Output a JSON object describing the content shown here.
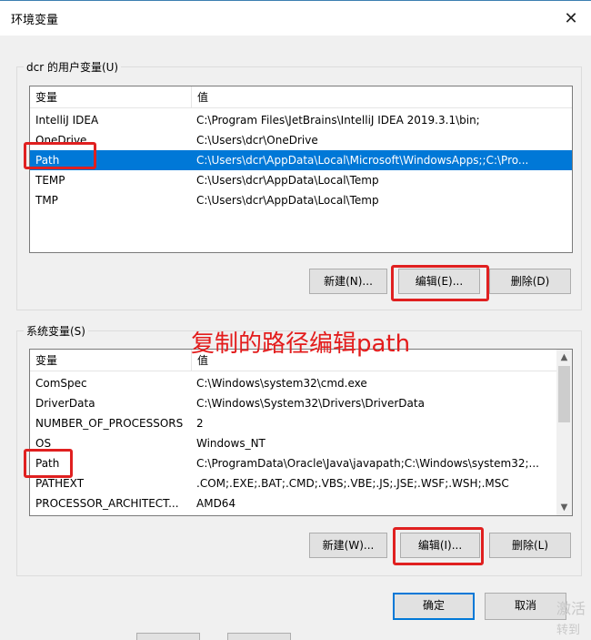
{
  "window": {
    "title": "环境变量",
    "close_glyph": "✕"
  },
  "user_vars": {
    "group_label": "dcr 的用户变量(U)",
    "col_var": "变量",
    "col_val": "值",
    "rows": [
      {
        "name": "IntelliJ IDEA",
        "value": "C:\\Program Files\\JetBrains\\IntelliJ IDEA 2019.3.1\\bin;"
      },
      {
        "name": "OneDrive",
        "value": "C:\\Users\\dcr\\OneDrive"
      },
      {
        "name": "Path",
        "value": "C:\\Users\\dcr\\AppData\\Local\\Microsoft\\WindowsApps;;C:\\Pro..."
      },
      {
        "name": "TEMP",
        "value": "C:\\Users\\dcr\\AppData\\Local\\Temp"
      },
      {
        "name": "TMP",
        "value": "C:\\Users\\dcr\\AppData\\Local\\Temp"
      }
    ],
    "buttons": {
      "new": "新建(N)...",
      "edit": "编辑(E)...",
      "delete": "删除(D)"
    }
  },
  "system_vars": {
    "group_label": "系统变量(S)",
    "col_var": "变量",
    "col_val": "值",
    "rows": [
      {
        "name": "ComSpec",
        "value": "C:\\Windows\\system32\\cmd.exe"
      },
      {
        "name": "DriverData",
        "value": "C:\\Windows\\System32\\Drivers\\DriverData"
      },
      {
        "name": "NUMBER_OF_PROCESSORS",
        "value": "2"
      },
      {
        "name": "OS",
        "value": "Windows_NT"
      },
      {
        "name": "Path",
        "value": "C:\\ProgramData\\Oracle\\Java\\javapath;C:\\Windows\\system32;..."
      },
      {
        "name": "PATHEXT",
        "value": ".COM;.EXE;.BAT;.CMD;.VBS;.VBE;.JS;.JSE;.WSF;.WSH;.MSC"
      },
      {
        "name": "PROCESSOR_ARCHITECT...",
        "value": "AMD64"
      }
    ],
    "buttons": {
      "new": "新建(W)...",
      "edit": "编辑(I)...",
      "delete": "删除(L)"
    }
  },
  "annotation_text": "复制的路径编辑path",
  "footer": {
    "ok": "确定",
    "cancel": "取消"
  },
  "watermark": {
    "line1": "激活",
    "line2": "转到"
  },
  "icons": {
    "close": "close-icon",
    "scroll_up": "chevron-up-icon",
    "scroll_down": "chevron-down-icon"
  },
  "colors": {
    "selection": "#0078d7",
    "annotation": "#e31c1c",
    "default_button_border": "#0078d7"
  }
}
